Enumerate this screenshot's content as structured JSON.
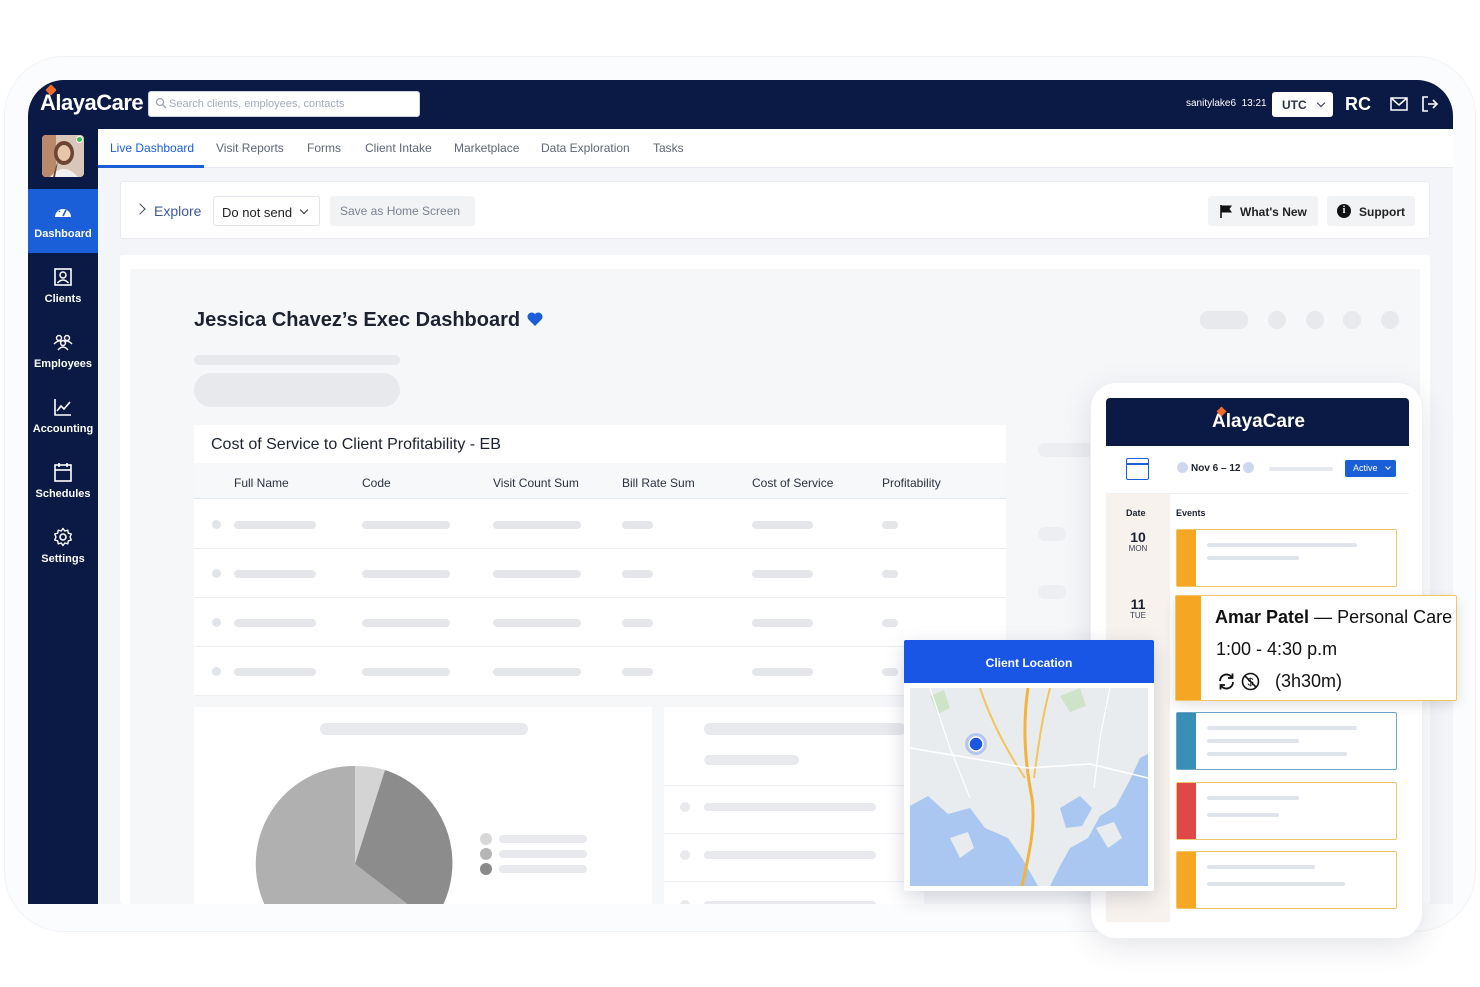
{
  "app": {
    "brand": "AlayaCare",
    "search_placeholder": "Search clients, employees, contacts",
    "user": "sanitylake6",
    "time": "13:21",
    "timezone": "UTC",
    "initials": "RC"
  },
  "sidebar": {
    "items": [
      {
        "label": "Dashboard",
        "icon": "dashboard-icon"
      },
      {
        "label": "Clients",
        "icon": "clients-icon"
      },
      {
        "label": "Employees",
        "icon": "employees-icon"
      },
      {
        "label": "Accounting",
        "icon": "accounting-icon"
      },
      {
        "label": "Schedules",
        "icon": "calendar-icon"
      },
      {
        "label": "Settings",
        "icon": "gear-icon"
      }
    ],
    "active": "Dashboard"
  },
  "tabs": [
    "Live Dashboard",
    "Visit Reports",
    "Forms",
    "Client Intake",
    "Marketplace",
    "Data Exploration",
    "Tasks"
  ],
  "actionbar": {
    "explore": "Explore",
    "send_option": "Do not send",
    "save_home": "Save as Home Screen",
    "whats_new": "What's New",
    "support": "Support"
  },
  "dashboard": {
    "title": "Jessica Chavez’s Exec Dashboard",
    "table": {
      "title": "Cost of Service to Client Profitability - EB",
      "columns": [
        "Full Name",
        "Code",
        "Visit Count Sum",
        "Bill Rate Sum",
        "Cost of Service",
        "Profitability"
      ]
    }
  },
  "mobile": {
    "brand": "AlayaCare",
    "week": "Nov 6 – 12",
    "status": "Active",
    "date_header": "Date",
    "events_header": "Events",
    "days": [
      {
        "num": "10",
        "name": "MON"
      },
      {
        "num": "11",
        "name": "TUE"
      }
    ],
    "event": {
      "client": "Amar Patel",
      "separator": "—",
      "service": "Personal Care",
      "time": "1:00 - 4:30 p.m",
      "duration": "(3h30m)"
    },
    "event_colors": [
      "#f5a623",
      "#f5a623",
      "#3a8fb7",
      "#e04848",
      "#f5a623"
    ]
  },
  "map": {
    "title": "Client Location"
  },
  "colors": {
    "navy": "#0b1a45",
    "accent": "#1a5ed8",
    "map_header": "#1956e6"
  }
}
